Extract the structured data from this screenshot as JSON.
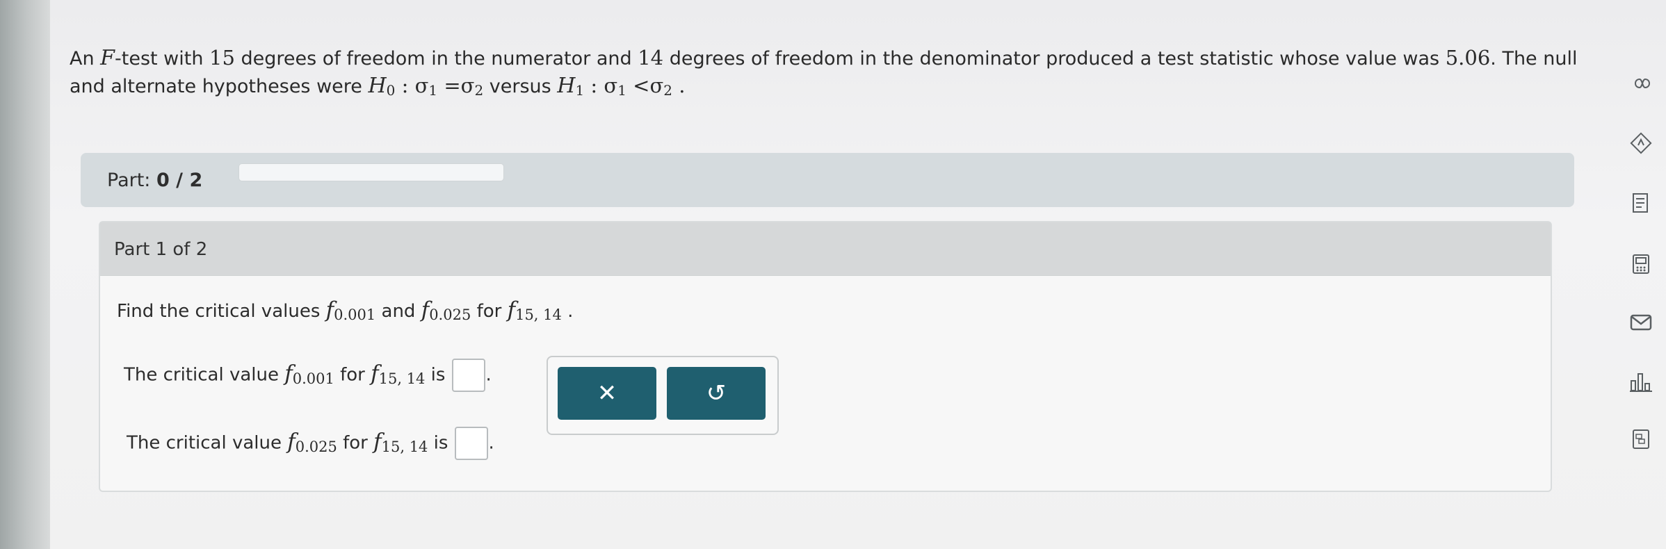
{
  "question": {
    "prefix": "An ",
    "F": "F",
    "text_a": "-test with ",
    "num_df": "15",
    "text_b": " degrees of freedom in the numerator and ",
    "den_df": "14",
    "text_c": " degrees of freedom in the denominator produced a test statistic whose value was ",
    "stat": "5.06",
    "text_d": ". The null",
    "line2_a": "and alternate hypotheses were ",
    "H": "H",
    "h0_sub": "0",
    "h0_body": " : σ",
    "s1": "1",
    "eq": " =σ",
    "s2": "2",
    "versus": " versus ",
    "h1_sub": "1",
    "h1_body": " : σ",
    "s1b": "1",
    "lt": " <σ",
    "s2b": "2",
    "end": " ."
  },
  "part_bar": {
    "label": "Part:",
    "progress": "0 / 2",
    "progress_fraction": 0
  },
  "card": {
    "title": "Part 1 of 2",
    "find_a": "Find the critical values ",
    "f": "f",
    "sub_001": "0.001",
    "and": " and ",
    "sub_025": "0.025",
    "for": " for ",
    "sub_dist": "15, 14",
    "dot": " .",
    "row1_a": "The critical value ",
    "row1_sub": "0.001",
    "row1_for": " for ",
    "row1_dist": "15, 14",
    "row1_is": " is",
    "row2_a": "The critical value ",
    "row2_sub": "0.025",
    "row2_for": " for ",
    "row2_dist": "15, 14",
    "row2_is": " is",
    "period": "."
  },
  "tools": {
    "clear": "✕",
    "undo": "↺"
  },
  "rail_icons": [
    "infinity-icon",
    "compass-icon",
    "book-icon",
    "calculator-icon",
    "mail-icon",
    "chart-icon",
    "data-icon"
  ]
}
